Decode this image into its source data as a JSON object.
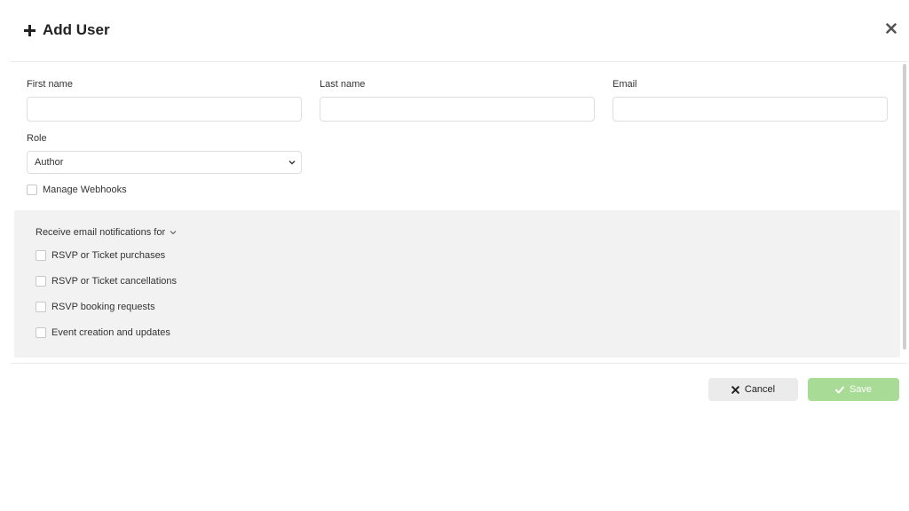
{
  "dialog": {
    "title": "Add User"
  },
  "form": {
    "first_name": {
      "label": "First name",
      "value": "",
      "placeholder": ""
    },
    "last_name": {
      "label": "Last name",
      "value": "",
      "placeholder": ""
    },
    "email": {
      "label": "Email",
      "value": "",
      "placeholder": ""
    },
    "role": {
      "label": "Role",
      "selected": "Author"
    },
    "manage_webhooks": {
      "label": "Manage Webhooks",
      "checked": false
    }
  },
  "notifications": {
    "title": "Receive email notifications for",
    "items": [
      {
        "label": "RSVP or Ticket purchases",
        "checked": false
      },
      {
        "label": "RSVP or Ticket cancellations",
        "checked": false
      },
      {
        "label": "RSVP booking requests",
        "checked": false
      },
      {
        "label": "Event creation and updates",
        "checked": false
      }
    ]
  },
  "footer": {
    "cancel_label": "Cancel",
    "save_label": "Save"
  },
  "icons": {
    "title": "plus-icon",
    "close": "close-icon",
    "select": "chevron-down-icon",
    "cancel": "x-icon",
    "save": "check-icon"
  },
  "colors": {
    "save_button": "#a8dc96",
    "cancel_button": "#ebebeb",
    "panel_background": "#f2f2f2"
  }
}
